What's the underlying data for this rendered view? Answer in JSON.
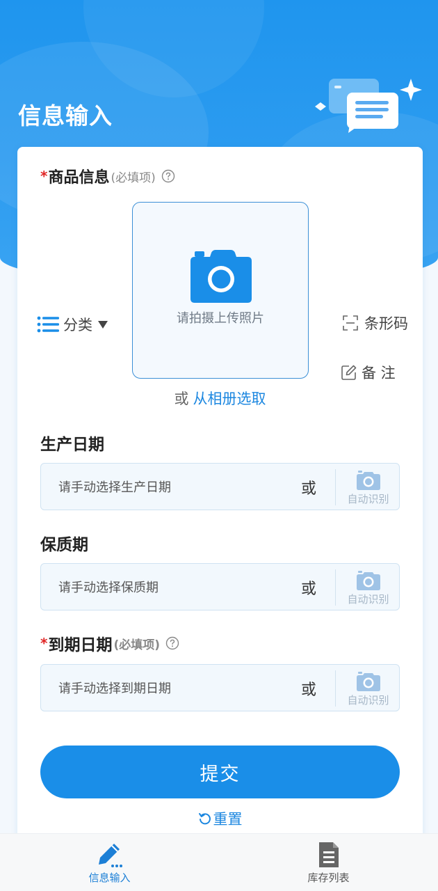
{
  "header": {
    "title": "信息输入"
  },
  "product": {
    "required_mark": "*",
    "label": "商品信息",
    "hint": "(必填项)",
    "photo_text": "请拍摄上传照片",
    "category_label": "分类",
    "barcode_label": "条形码",
    "note_label": "备 注",
    "album_or": "或",
    "album_link": "从相册选取"
  },
  "fields": [
    {
      "label": "生产日期",
      "placeholder": "请手动选择生产日期",
      "or": "或",
      "auto_label": "自动识别"
    },
    {
      "label": "保质期",
      "placeholder": "请手动选择保质期",
      "or": "或",
      "auto_label": "自动识别"
    },
    {
      "required_mark": "*",
      "label": "到期日期",
      "hint": "(必填项)",
      "placeholder": "请手动选择到期日期",
      "or": "或",
      "auto_label": "自动识别"
    }
  ],
  "actions": {
    "submit": "提交",
    "reset": "重置"
  },
  "tabbar": [
    {
      "label": "信息输入",
      "icon": "pencil-icon",
      "active": true
    },
    {
      "label": "库存列表",
      "icon": "document-icon",
      "active": false
    }
  ],
  "colors": {
    "primary": "#1a8ee8",
    "required": "#e02525",
    "link": "#1c87e0"
  }
}
